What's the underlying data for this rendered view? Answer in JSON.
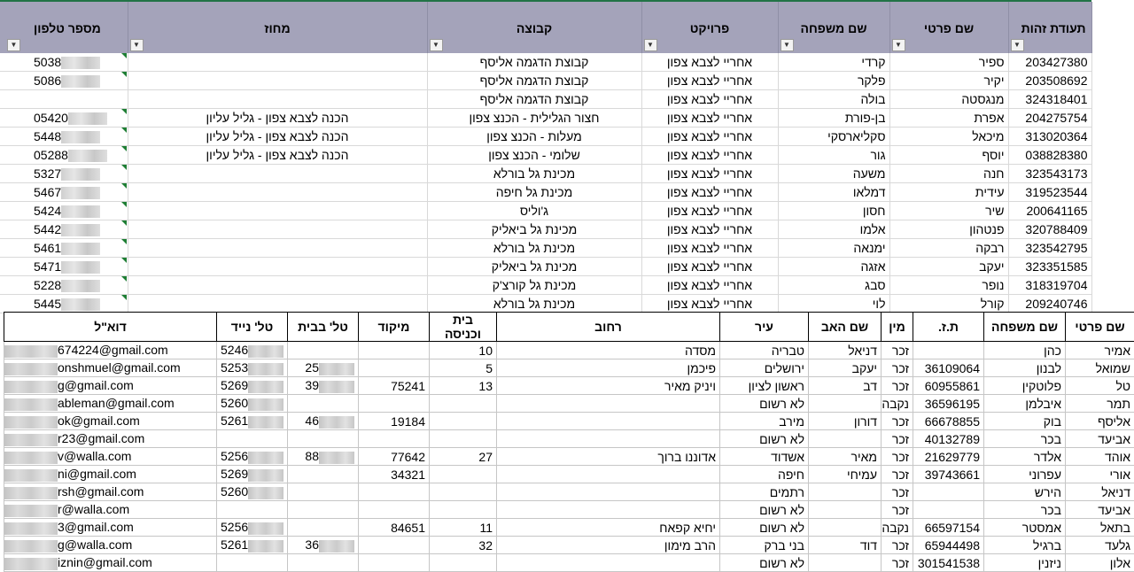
{
  "top": {
    "headers": {
      "id": "תעודת זהות",
      "first": "שם פרטי",
      "last": "שם משפחה",
      "project": "פרויקט",
      "group": "קבוצה",
      "district": "מחוז",
      "phone": "מספר טלפון"
    },
    "filter_icon": "dropdown-arrow-icon",
    "rows": [
      {
        "id": "203427380",
        "first": "ספיר",
        "last": "קרדי",
        "project": "אחריי לצבא צפון",
        "group": "קבוצת הדגמה אליסף",
        "district": "",
        "phone": "5038"
      },
      {
        "id": "203508692",
        "first": "יקיר",
        "last": "פלקר",
        "project": "אחריי לצבא צפון",
        "group": "קבוצת הדגמה אליסף",
        "district": "",
        "phone": "5086"
      },
      {
        "id": "324318401",
        "first": "מנגסטה",
        "last": "בולה",
        "project": "אחריי לצבא צפון",
        "group": "קבוצת הדגמה אליסף",
        "district": "",
        "phone": ""
      },
      {
        "id": "204275754",
        "first": "אפרת",
        "last": "בן-פורת",
        "project": "אחריי לצבא צפון",
        "group": "חצור הגלילית - הכנצ צפון",
        "district": "הכנה לצבא צפון - גליל עליון",
        "phone": "05420"
      },
      {
        "id": "313020364",
        "first": "מיכאל",
        "last": "סקליארסקי",
        "project": "אחריי לצבא צפון",
        "group": "מעלות - הכנצ צפון",
        "district": "הכנה לצבא צפון - גליל עליון",
        "phone": "5448"
      },
      {
        "id": "038828380",
        "first": "יוסף",
        "last": "גור",
        "project": "אחריי לצבא צפון",
        "group": "שלומי - הכנצ צפון",
        "district": "הכנה לצבא צפון - גליל עליון",
        "phone": "05288"
      },
      {
        "id": "323543173",
        "first": "חנה",
        "last": "משעה",
        "project": "אחריי לצבא צפון",
        "group": "מכינת גל בורלא",
        "district": "",
        "phone": "5327"
      },
      {
        "id": "319523544",
        "first": "עידית",
        "last": "דמלאו",
        "project": "אחריי לצבא צפון",
        "group": "מכינת גל חיפה",
        "district": "",
        "phone": "5467"
      },
      {
        "id": "200641165",
        "first": "שיר",
        "last": "חסון",
        "project": "אחריי לצבא צפון",
        "group": "ג'וליס",
        "district": "",
        "phone": "5424"
      },
      {
        "id": "320788409",
        "first": "פנטהון",
        "last": "אלמו",
        "project": "אחריי לצבא צפון",
        "group": "מכינת גל ביאליק",
        "district": "",
        "phone": "5442"
      },
      {
        "id": "323542795",
        "first": "רבקה",
        "last": "ימנאה",
        "project": "אחריי לצבא צפון",
        "group": "מכינת גל בורלא",
        "district": "",
        "phone": "5461"
      },
      {
        "id": "323351585",
        "first": "יעקב",
        "last": "אזגה",
        "project": "אחריי לצבא צפון",
        "group": "מכינת גל ביאליק",
        "district": "",
        "phone": "5471"
      },
      {
        "id": "318319704",
        "first": "נופר",
        "last": "סבג",
        "project": "אחריי לצבא צפון",
        "group": "מכינת גל קורצ'ק",
        "district": "",
        "phone": "5228"
      },
      {
        "id": "209240746",
        "first": "קורל",
        "last": "לוי",
        "project": "אחריי לצבא צפון",
        "group": "מכינת גל בורלא",
        "district": "",
        "phone": "5445"
      }
    ]
  },
  "bottom": {
    "headers": {
      "first": "שם פרטי",
      "last": "שם משפחה",
      "tz": "ת.ז.",
      "gender": "מין",
      "father": "שם האב",
      "city": "עיר",
      "street": "רחוב",
      "house": "בית וכניסה",
      "zip": "מיקוד",
      "home_phone": "טל' בבית",
      "mobile": "טל' נייד",
      "email": "דוא\"ל"
    },
    "rows": [
      {
        "first": "אמיר",
        "last": "כהן",
        "tz": "",
        "gender": "זכר",
        "father": "דניאל",
        "city": "טבריה",
        "street": "מסדה",
        "house": "10",
        "zip": "",
        "home_phone": "",
        "mobile": "5246",
        "email": "674224@gmail.com"
      },
      {
        "first": "שמואל",
        "last": "לבנון",
        "tz": "36109064",
        "gender": "זכר",
        "father": "יעקב",
        "city": "ירושלים",
        "street": "פיכמן",
        "house": "5",
        "zip": "",
        "home_phone": "25",
        "mobile": "5253",
        "email": "onshmuel@gmail.com"
      },
      {
        "first": "טל",
        "last": "פלוטקין",
        "tz": "60955861",
        "gender": "זכר",
        "father": "דב",
        "city": "ראשון לציון",
        "street": "ויניק מאיר",
        "house": "13",
        "zip": "75241",
        "home_phone": "39",
        "mobile": "5269",
        "email": "g@gmail.com"
      },
      {
        "first": "תמר",
        "last": "איבלמן",
        "tz": "36596195",
        "gender": "נקבה",
        "father": "",
        "city": "לא רשום",
        "street": "",
        "house": "",
        "zip": "",
        "home_phone": "",
        "mobile": "5260",
        "email": "ableman@gmail.com"
      },
      {
        "first": "אליסף",
        "last": "בוק",
        "tz": "66678855",
        "gender": "זכר",
        "father": "דורון",
        "city": "מירב",
        "street": "",
        "house": "",
        "zip": "19184",
        "home_phone": "46",
        "mobile": "5261",
        "email": "ok@gmail.com"
      },
      {
        "first": "אביעד",
        "last": "בכר",
        "tz": "40132789",
        "gender": "זכר",
        "father": "",
        "city": "לא רשום",
        "street": "",
        "house": "",
        "zip": "",
        "home_phone": "",
        "mobile": "",
        "email": "r23@gmail.com"
      },
      {
        "first": "אוהד",
        "last": "אלדר",
        "tz": "21629779",
        "gender": "זכר",
        "father": "מאיר",
        "city": "אשדוד",
        "street": "אדוננו ברוך",
        "house": "27",
        "zip": "77642",
        "home_phone": "88",
        "mobile": "5256",
        "email": "v@walla.com"
      },
      {
        "first": "אורי",
        "last": "עפרוני",
        "tz": "39743661",
        "gender": "זכר",
        "father": "עמיחי",
        "city": "חיפה",
        "street": "",
        "house": "",
        "zip": "34321",
        "home_phone": "",
        "mobile": "5269",
        "email": "ni@gmail.com"
      },
      {
        "first": "דניאל",
        "last": "הירש",
        "tz": "",
        "gender": "זכר",
        "father": "",
        "city": "רתמים",
        "street": "",
        "house": "",
        "zip": "",
        "home_phone": "",
        "mobile": "5260",
        "email": "rsh@gmail.com"
      },
      {
        "first": "אביעד",
        "last": "בכר",
        "tz": "",
        "gender": "זכר",
        "father": "",
        "city": "לא רשום",
        "street": "",
        "house": "",
        "zip": "",
        "home_phone": "",
        "mobile": "",
        "email": "r@walla.com"
      },
      {
        "first": "בתאל",
        "last": "אמסטר",
        "tz": "66597154",
        "gender": "נקבה",
        "father": "",
        "city": "לא רשום",
        "street": "יחיא קפאח",
        "house": "11",
        "zip": "84651",
        "home_phone": "",
        "mobile": "5256",
        "email": "3@gmail.com"
      },
      {
        "first": "גלעד",
        "last": "ברגיל",
        "tz": "65944498",
        "gender": "זכר",
        "father": "דוד",
        "city": "בני ברק",
        "street": "הרב מימון",
        "house": "32",
        "zip": "",
        "home_phone": "36",
        "mobile": "5261",
        "email": "g@walla.com"
      },
      {
        "first": "אלון",
        "last": "ניזנין",
        "tz": "301541538",
        "gender": "זכר",
        "father": "",
        "city": "לא רשום",
        "street": "",
        "house": "",
        "zip": "",
        "home_phone": "",
        "mobile": "",
        "email": "iznin@gmail.com"
      }
    ]
  }
}
